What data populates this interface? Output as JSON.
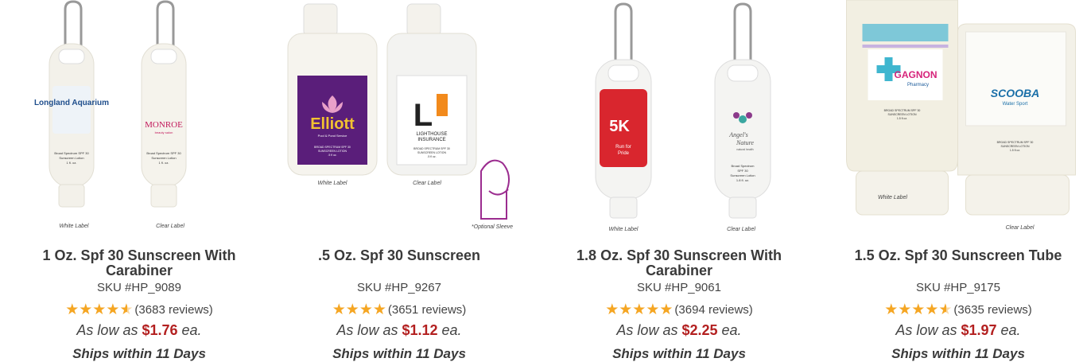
{
  "products": [
    {
      "title": "1 Oz. Spf 30 Sunscreen With Carabiner",
      "sku": "SKU #HP_9089",
      "reviews": "(3683 reviews)",
      "rating": 4.5,
      "price_prefix": "As low as",
      "price": "$1.76",
      "price_suffix": "ea.",
      "ships": "Ships within 11 Days",
      "image_labels": [
        "White Label",
        "Clear Label"
      ],
      "bottle_text": [
        "Longland Aquarium",
        "MONROE",
        "beauty salon",
        "Broad Spectrum SPF 30",
        "Sunscreen Lotion",
        "1 fl. oz.",
        "Broad Spectrum SPF 30",
        "Sunscreen Lotion",
        "1 fl. oz."
      ]
    },
    {
      "title": ".5 Oz. Spf 30 Sunscreen",
      "sku": "SKU #HP_9267",
      "reviews": "(3651 reviews)",
      "rating": 4,
      "price_prefix": "As low as",
      "price": "$1.12",
      "price_suffix": "ea.",
      "ships": "Ships within 11 Days",
      "image_labels": [
        "White Label",
        "Clear Label",
        "*Optional Sleeve"
      ],
      "bottle_text": [
        "Elliott",
        "Pool & Pond Service",
        "BROAD SPECTRUM SPF 30",
        "SUNSCREEN LOTION",
        ".5 fl oz.",
        "LIGHTHOUSE",
        "INSURANCE",
        "BROAD SPECTRUM SPF 30",
        "SUNSCREEN LOTION",
        ".5 fl oz."
      ]
    },
    {
      "title": "1.8 Oz. Spf 30 Sunscreen With Carabiner",
      "sku": "SKU #HP_9061",
      "reviews": "(3694 reviews)",
      "rating": 5,
      "price_prefix": "As low as",
      "price": "$2.25",
      "price_suffix": "ea.",
      "ships": "Ships within 11 Days",
      "image_labels": [
        "White Label",
        "Clear Label"
      ],
      "bottle_text": [
        "5K",
        "Run for",
        "Pride",
        "Angel's",
        "Nature",
        "natural health",
        "Broad Spectrum",
        "SPF 30",
        "Sunscreen Lotion",
        "1.8 fl. oz."
      ]
    },
    {
      "title": "1.5 Oz. Spf 30 Sunscreen Tube",
      "sku": "SKU #HP_9175",
      "reviews": "(3635 reviews)",
      "rating": 4.5,
      "price_prefix": "As low as",
      "price": "$1.97",
      "price_suffix": "ea.",
      "ships": "Ships within 11 Days",
      "image_labels": [
        "White Label",
        "Clear Label"
      ],
      "bottle_text": [
        "GAGNON",
        "Pharmacy",
        "BROAD SPECTRUM SPF 30",
        "SUNSCREEN LOTION",
        "1.5 fl oz.",
        "SCOOBA",
        "Water Sport",
        "BROAD SPECTRUM SPF 30",
        "SUNSCREEN LOTION",
        "1.5 fl oz."
      ]
    }
  ],
  "colors": {
    "star": "#f5a623",
    "price": "#b32020",
    "text": "#3a3a3a"
  }
}
